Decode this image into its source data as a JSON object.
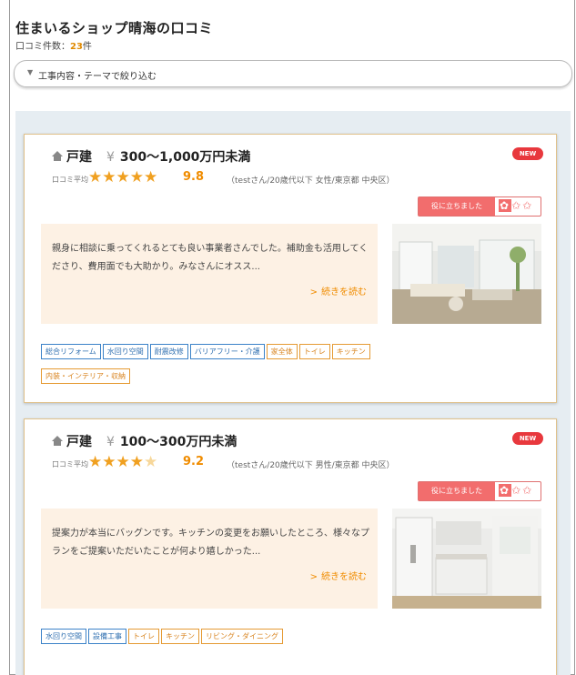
{
  "page": {
    "title": "住まいるショップ晴海の口コミ",
    "review_count_label": "口コミ件数：",
    "review_count": "23",
    "review_count_unit": "件",
    "filter_label": "工事内容・テーマで絞り込む"
  },
  "colors": {
    "accent": "#f08c00",
    "new_badge": "#e8383d",
    "helpful": "#f26d6d",
    "tag_blue": "#3b82c8",
    "tag_orange": "#e59a33",
    "excerpt_bg": "#fdf1e4"
  },
  "reviews": [
    {
      "type": "戸建",
      "price": "300～1,000万円未満",
      "badge": "NEW",
      "avg_label": "口コミ平均",
      "rating": 5,
      "stars_full": "★★★★★",
      "stars_rest": "",
      "score": "9.8",
      "reviewer": "（testさん/20歳代以下 女性/東京都 中央区）",
      "helpful_label": "役に立ちました",
      "excerpt": "親身に相談に乗ってくれるとても良い事業者さんでした。補助金も活用してくださり、費用面でも大助かり。みなさんにオスス...",
      "more_label": "続きを読む",
      "tags": [
        {
          "label": "総合リフォーム",
          "color": "blue"
        },
        {
          "label": "水回り空間",
          "color": "blue"
        },
        {
          "label": "耐震改修",
          "color": "blue"
        },
        {
          "label": "バリアフリー・介護",
          "color": "blue"
        },
        {
          "label": "家全体",
          "color": "orange"
        },
        {
          "label": "トイレ",
          "color": "orange"
        },
        {
          "label": "キッチン",
          "color": "orange"
        },
        {
          "label": "内装・インテリア・収納",
          "color": "orange"
        }
      ]
    },
    {
      "type": "戸建",
      "price": "100～300万円未満",
      "badge": "NEW",
      "avg_label": "口コミ平均",
      "rating": 4.5,
      "stars_full": "★★★★",
      "stars_rest": "★",
      "score": "9.2",
      "reviewer": "（testさん/20歳代以下 男性/東京都 中央区）",
      "helpful_label": "役に立ちました",
      "excerpt": "提案力が本当にバッグンです。キッチンの変更をお願いしたところ、様々なプランをご提案いただいたことが何より嬉しかった...",
      "more_label": "続きを読む",
      "tags": [
        {
          "label": "水回り空間",
          "color": "blue"
        },
        {
          "label": "設備工事",
          "color": "blue"
        },
        {
          "label": "トイレ",
          "color": "orange"
        },
        {
          "label": "キッチン",
          "color": "orange"
        },
        {
          "label": "リビング・ダイニング",
          "color": "orange"
        }
      ]
    }
  ]
}
